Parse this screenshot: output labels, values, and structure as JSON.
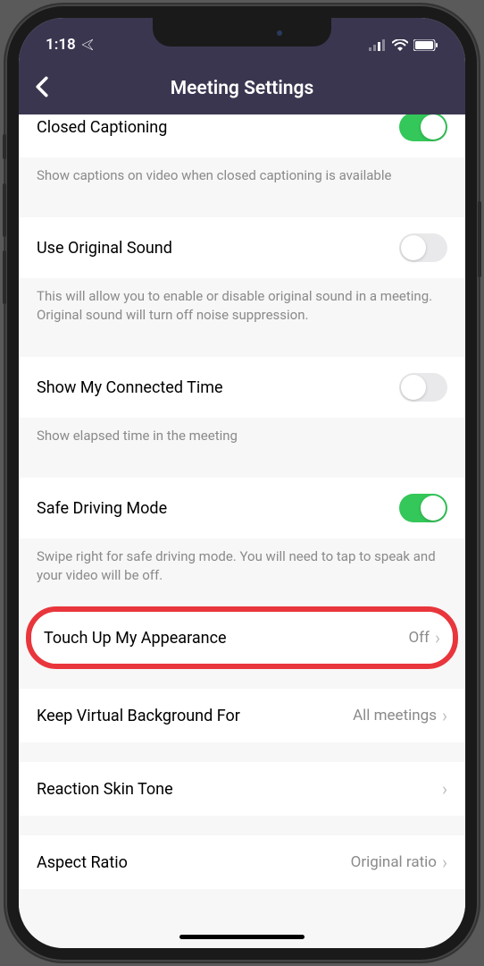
{
  "status": {
    "time": "1:18"
  },
  "header": {
    "title": "Meeting Settings"
  },
  "settings": {
    "closedCaptioning": {
      "label": "Closed Captioning",
      "desc": "Show captions on video when closed captioning is available",
      "on": true
    },
    "originalSound": {
      "label": "Use Original Sound",
      "desc": "This will allow you to enable or disable original sound in a meeting. Original sound will turn off noise suppression.",
      "on": false
    },
    "connectedTime": {
      "label": "Show My Connected Time",
      "desc": "Show elapsed time in the meeting",
      "on": false
    },
    "safeDriving": {
      "label": "Safe Driving Mode",
      "desc": "Swipe right for safe driving mode. You will need to tap to speak and your video will be off.",
      "on": true
    },
    "touchUp": {
      "label": "Touch Up My Appearance",
      "value": "Off"
    },
    "virtualBg": {
      "label": "Keep Virtual Background For",
      "value": "All meetings"
    },
    "skinTone": {
      "label": "Reaction Skin Tone",
      "value": ""
    },
    "aspectRatio": {
      "label": "Aspect Ratio",
      "value": "Original ratio"
    }
  }
}
